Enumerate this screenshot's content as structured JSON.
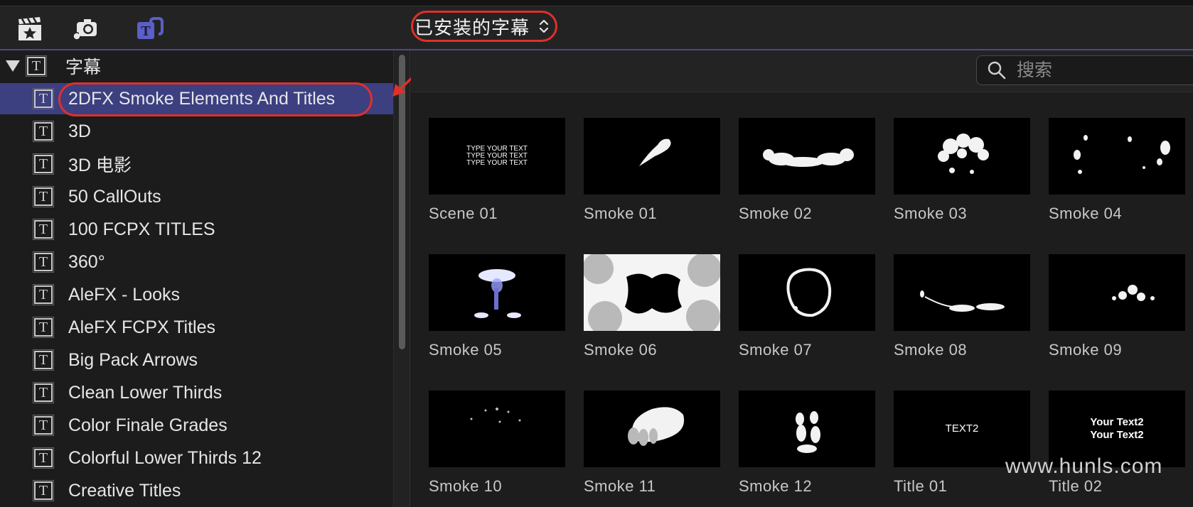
{
  "toolbar": {
    "icons": [
      "clapperboard-star-icon",
      "music-camera-icon",
      "titles-icon"
    ],
    "selector_label": "已安装的字幕",
    "accent": "#e0302a"
  },
  "sidebar": {
    "root_label": "字幕",
    "items": [
      {
        "label": "2DFX Smoke Elements And Titles",
        "selected": true
      },
      {
        "label": "3D"
      },
      {
        "label": "3D 电影"
      },
      {
        "label": "50 CallOuts"
      },
      {
        "label": "100 FCPX TITLES"
      },
      {
        "label": "360°"
      },
      {
        "label": "AleFX - Looks"
      },
      {
        "label": "AleFX FCPX Titles"
      },
      {
        "label": "Big Pack Arrows"
      },
      {
        "label": "Clean Lower Thirds"
      },
      {
        "label": "Color Finale Grades"
      },
      {
        "label": "Colorful Lower Thirds 12"
      },
      {
        "label": "Creative Titles"
      }
    ],
    "selected_color": "#3c3f80"
  },
  "search": {
    "placeholder": "搜索"
  },
  "grid": {
    "tiles": [
      {
        "label": "Scene 01",
        "thumb_text": [
          "TYPE YOUR TEXT",
          "TYPE YOUR TEXT",
          "TYPE YOUR TEXT"
        ]
      },
      {
        "label": "Smoke 01"
      },
      {
        "label": "Smoke 02"
      },
      {
        "label": "Smoke 03"
      },
      {
        "label": "Smoke 04"
      },
      {
        "label": "Smoke 05"
      },
      {
        "label": "Smoke 06"
      },
      {
        "label": "Smoke 07"
      },
      {
        "label": "Smoke 08"
      },
      {
        "label": "Smoke 09"
      },
      {
        "label": "Smoke 10"
      },
      {
        "label": "Smoke 11"
      },
      {
        "label": "Smoke 12"
      },
      {
        "label": "Title 01",
        "thumb_text": [
          "TEXT2"
        ]
      },
      {
        "label": "Title 02",
        "thumb_text": [
          "Your Text2",
          "Your Text2"
        ]
      }
    ]
  },
  "watermark": "www.hunls.com"
}
